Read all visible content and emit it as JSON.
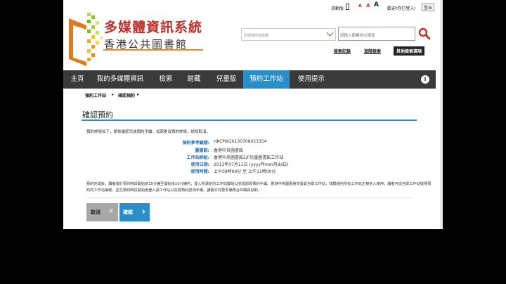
{
  "topbar": {
    "mobile": "流動版",
    "font_sizes": [
      "A",
      "A",
      "A"
    ],
    "welcome": "歡迎!你已登入!",
    "logout": "登出"
  },
  "logo": {
    "title": "多媒體資訊系統",
    "subtitle": "香港公共圖書館"
  },
  "search": {
    "select_placeholder": "請選擇所有館藏",
    "input_placeholder": "請輸入關鍵詞以搜尋",
    "links": [
      "檢索記錄",
      "進階檢索",
      "其他檢索選項"
    ]
  },
  "nav": {
    "items": [
      "主頁",
      "我的多媒體資訊",
      "檢索",
      "館藏",
      "兒童版",
      "預約工作站",
      "使用提示"
    ],
    "info": "i"
  },
  "breadcrumb": [
    "預約工作站",
    "確認預約"
  ],
  "page_title": "確認預約",
  "intro": "預約詳情如下，請按確認完成預約手續。如需更改預約詳情，請按取消。",
  "details": [
    {
      "label": "預約參考編號:",
      "value": "HKCPW20130708053354"
    },
    {
      "label": "圖書館:",
      "value": "香港中央圖書館"
    },
    {
      "label": "工作站群組:",
      "value": "香港中央圖書館2/F兒童圖書館工作站"
    },
    {
      "label": "使用日期:",
      "value": "2013年07月11日 (yyyy年mm月dd日)"
    },
    {
      "label": "使用時間:",
      "value": "上午09時00分 至 上午11時00分"
    }
  ],
  "notice": "預約完成後，讀者請於預約時段開始前15分鐘至開始後10分鐘內，登入所選定的工作站群組以完成認領預約手續。香港中央圖書館亦設置自助工作站，如群組內所有工作站正被他人使用，讀者可從自助工作站檢視預約的工作站編號，並在預約時段開始後登入該工作站以完成預約認領手續。讀者亦可要求服務台的職員協助。",
  "buttons": {
    "cancel": "取消",
    "confirm": "確認"
  },
  "colors": {
    "accent": "#2a8fc8",
    "brand": "#c0302b",
    "nav": "#3a3a3a"
  }
}
